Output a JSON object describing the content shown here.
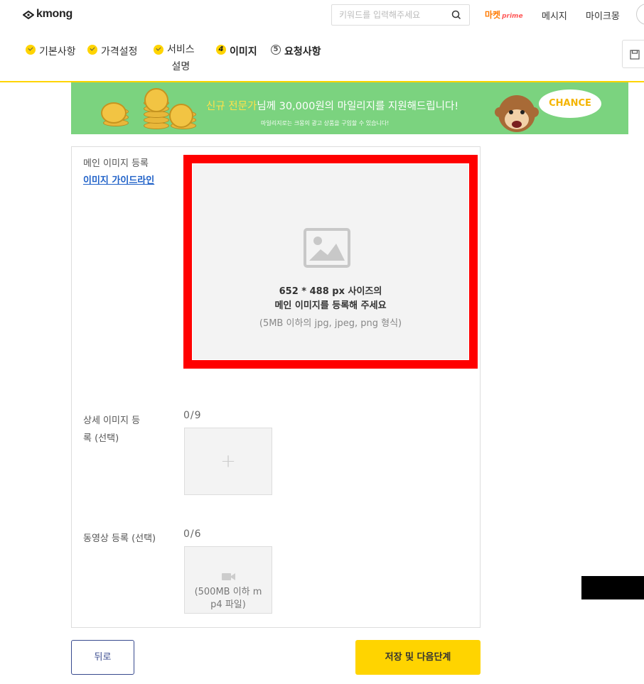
{
  "header": {
    "logo": "kmong",
    "search_placeholder": "키워드를 입력해주세요",
    "nav": {
      "prime_label": "마켓",
      "prime_sub": "prime",
      "messages": "메시지",
      "mykmong": "마이크몽"
    }
  },
  "steps": [
    {
      "label": "기본사항",
      "state": "done"
    },
    {
      "label": "가격설정",
      "state": "done"
    },
    {
      "label": "서비스",
      "label2": "설명",
      "state": "done"
    },
    {
      "label": "이미지",
      "num": "4",
      "state": "active"
    },
    {
      "label": "요청사항",
      "num": "5",
      "state": "pending"
    }
  ],
  "banner": {
    "headline_highlight": "신규 전문가",
    "headline_rest": "님께 30,000원의 마일리지를 지원해드립니다!",
    "sub": "마일리지로는 크몽의 광고 상품을 구입할 수 있습니다!",
    "badge": "CHANCE"
  },
  "form": {
    "main_image": {
      "label": "메인 이미지 등록",
      "guide_link": "이미지 가이드라인",
      "line1": "652 * 488 px 사이즈의",
      "line2": "메인 이미지를 등록해 주세요",
      "line3": "(5MB 이하의 jpg, jpeg, png 형식)"
    },
    "detail_images": {
      "label_line1": "상세 이미지 등",
      "label_line2": "록 (선택)",
      "count": "0/9",
      "plus": "+"
    },
    "video": {
      "label": "동영상 등록 (선택)",
      "count": "0/6",
      "caption_line1": "(500MB 이하 m",
      "caption_line2": "p4 파일)"
    }
  },
  "buttons": {
    "back": "뒤로",
    "next": "저장 및 다음단계"
  },
  "colors": {
    "accent": "#ffd400",
    "highlight_border": "#ff0000",
    "link": "#1f61c8",
    "banner_bg": "#7bd37f"
  }
}
